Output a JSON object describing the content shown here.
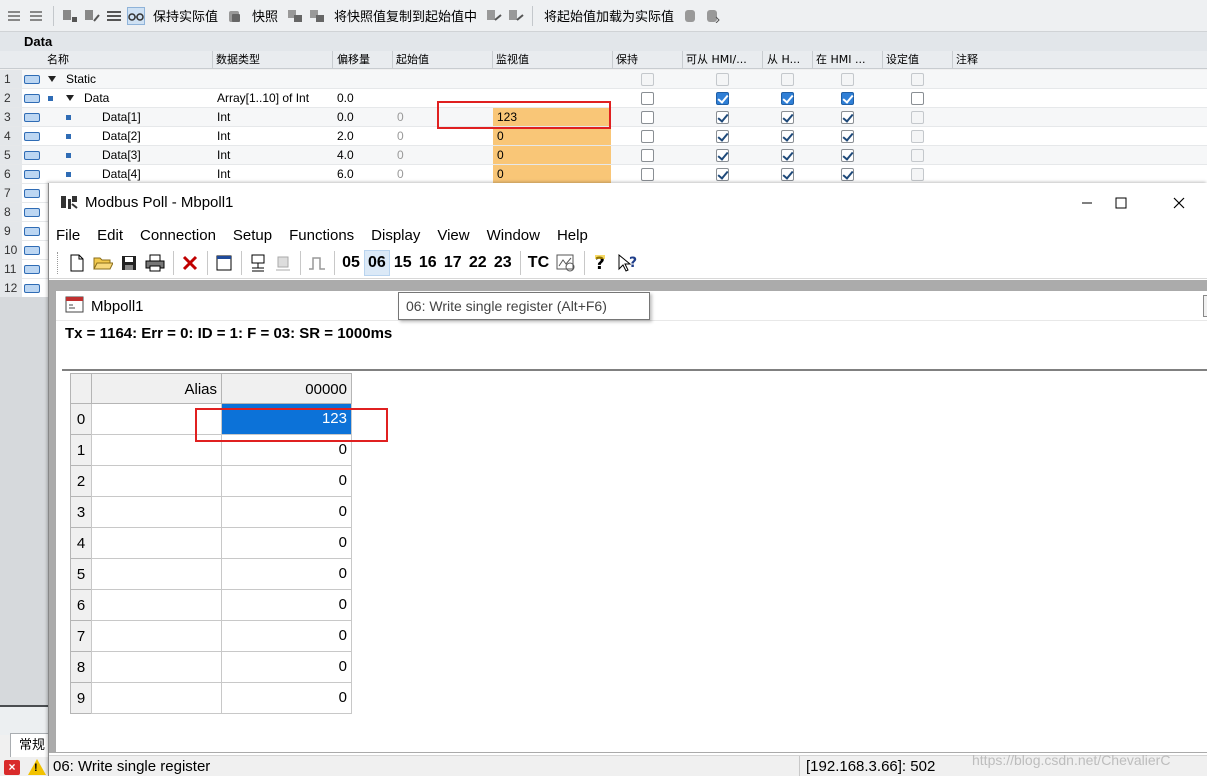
{
  "tia": {
    "toolbar": {
      "keep_actual_label": "保持实际值",
      "snapshot_label": "快照",
      "copy_snapshot_label": "将快照值复制到起始值中",
      "load_start_label": "将起始值加载为实际值"
    },
    "block_title": "Data",
    "columns": {
      "name": "名称",
      "datatype": "数据类型",
      "offset": "偏移量",
      "start": "起始值",
      "monitor": "监视值",
      "retain": "保持",
      "hmi_access": "可从 HMI/...",
      "from_hmi": "从 H...",
      "in_hmi": "在 HMI ...",
      "setpoint": "设定值",
      "comment": "注释"
    },
    "rows": [
      {
        "num": "1",
        "name": "Static",
        "datatype": "",
        "offset": "",
        "start": "",
        "monitor": ""
      },
      {
        "num": "2",
        "name": "Data",
        "datatype": "Array[1..10] of Int",
        "offset": "0.0",
        "start": "",
        "monitor": ""
      },
      {
        "num": "3",
        "name": "Data[1]",
        "datatype": "Int",
        "offset": "0.0",
        "start": "0",
        "monitor": "123"
      },
      {
        "num": "4",
        "name": "Data[2]",
        "datatype": "Int",
        "offset": "2.0",
        "start": "0",
        "monitor": "0"
      },
      {
        "num": "5",
        "name": "Data[3]",
        "datatype": "Int",
        "offset": "4.0",
        "start": "0",
        "monitor": "0"
      },
      {
        "num": "6",
        "name": "Data[4]",
        "datatype": "Int",
        "offset": "6.0",
        "start": "0",
        "monitor": "0"
      }
    ],
    "hidden_row_numbers": [
      "7",
      "8",
      "9",
      "10",
      "11",
      "12"
    ],
    "bottom_tab": "常规",
    "colors": {
      "monitor_highlight": "#f9c677",
      "red_box": "#e02020"
    }
  },
  "modbus": {
    "window_title": "Modbus Poll - Mbpoll1",
    "menu": [
      "File",
      "Edit",
      "Connection",
      "Setup",
      "Functions",
      "Display",
      "View",
      "Window",
      "Help"
    ],
    "function_buttons": [
      "05",
      "06",
      "15",
      "16",
      "17",
      "22",
      "23"
    ],
    "tc_label": "TC",
    "child_title": "Mbpoll1",
    "status_line": "Tx = 1164: Err = 0: ID = 1: F = 03: SR = 1000ms",
    "grid": {
      "alias_header": "Alias",
      "col_header": "00000",
      "rows": [
        {
          "index": "0",
          "value": "123"
        },
        {
          "index": "1",
          "value": "0"
        },
        {
          "index": "2",
          "value": "0"
        },
        {
          "index": "3",
          "value": "0"
        },
        {
          "index": "4",
          "value": "0"
        },
        {
          "index": "5",
          "value": "0"
        },
        {
          "index": "6",
          "value": "0"
        },
        {
          "index": "7",
          "value": "0"
        },
        {
          "index": "8",
          "value": "0"
        },
        {
          "index": "9",
          "value": "0"
        }
      ]
    },
    "tooltip": "06: Write single register (Alt+F6)",
    "statusbar_left": "06: Write single register",
    "statusbar_right": "[192.168.3.66]: 502",
    "colors": {
      "selected_cell": "#0c72d8"
    }
  },
  "watermark": "https://blog.csdn.net/ChevalierC"
}
